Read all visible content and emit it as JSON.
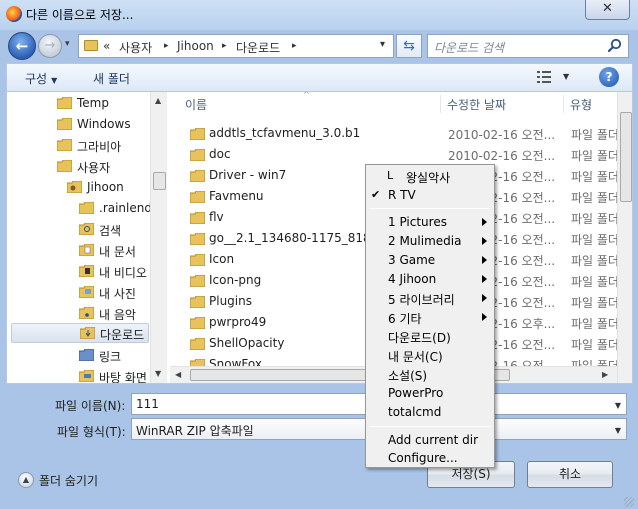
{
  "window": {
    "title": "다른 이름으로 저장...",
    "close_glyph": "✕"
  },
  "navigation": {
    "back_glyph": "←",
    "forward_glyph": "→",
    "dropdown_glyph": "▾"
  },
  "address": {
    "overflow": "«",
    "crumbs": [
      "사용자",
      "Jihoon",
      "다운로드"
    ],
    "separator": "▸",
    "refresh_glyph": "⇆"
  },
  "search": {
    "placeholder": "다운로드 검색"
  },
  "toolbar": {
    "organize": "구성",
    "new_folder": "새 폴더",
    "help": "?"
  },
  "nav_tree": [
    {
      "label": "Temp"
    },
    {
      "label": "Windows"
    },
    {
      "label": "그라비아"
    },
    {
      "label": "사용자"
    },
    {
      "label": "Jihoon"
    },
    {
      "label": ".rainlenda"
    },
    {
      "label": "검색"
    },
    {
      "label": "내 문서"
    },
    {
      "label": "내 비디오"
    },
    {
      "label": "내 사진"
    },
    {
      "label": "내 음악"
    },
    {
      "label": "다운로드"
    },
    {
      "label": "링크"
    },
    {
      "label": "바탕 화면"
    }
  ],
  "file_list": {
    "columns": [
      "이름",
      "수정한 날짜",
      "유형"
    ],
    "rows": [
      {
        "name": "addtls_tcfavmenu_3.0.b1",
        "date": "2010-02-16 오전...",
        "type": "파일 폴더"
      },
      {
        "name": "doc",
        "date": "2010-02-16 오전...",
        "type": "파일 폴더"
      },
      {
        "name": "Driver - win7",
        "date": "2010-02-16 오전...",
        "type": "파일 폴더"
      },
      {
        "name": "Favmenu",
        "date": "2010-02-16 오전...",
        "type": "파일 폴더"
      },
      {
        "name": "flv",
        "date": "2010-02-16 오전...",
        "type": "파일 폴더"
      },
      {
        "name": "go__2.1_134680-1175_818",
        "date": "2010-02-16 오전...",
        "type": "파일 폴더"
      },
      {
        "name": "Icon",
        "date": "2010-02-16 오전...",
        "type": "파일 폴더"
      },
      {
        "name": "Icon-png",
        "date": "2010-02-16 오전...",
        "type": "파일 폴더"
      },
      {
        "name": "Plugins",
        "date": "2010-02-16 오전...",
        "type": "파일 폴더"
      },
      {
        "name": "pwrpro49",
        "date": "2010-02-16 오후...",
        "type": "파일 폴더"
      },
      {
        "name": "ShellOpacity",
        "date": "2010-02-16 오전...",
        "type": "파일 폴더"
      },
      {
        "name": "SnowFox",
        "date": "2010-02-16 오전...",
        "type": "파일 폴더"
      }
    ]
  },
  "form": {
    "filename_label": "파일 이름(N):",
    "filename_value": "111",
    "filetype_label": "파일 형식(T):",
    "filetype_value": "WinRAR ZIP 압축파일"
  },
  "footer": {
    "hide_folders": "폴더 숨기기",
    "save": "저장(S)",
    "cancel": "취소"
  },
  "context_menu": {
    "items_top": [
      {
        "mark": "L",
        "label": "왕실악사"
      },
      {
        "mark": "✔",
        "label": "R   TV"
      }
    ],
    "items_sub": [
      {
        "label": "1 Pictures"
      },
      {
        "label": "2 Mulimedia"
      },
      {
        "label": "3 Game"
      },
      {
        "label": "4 Jihoon"
      },
      {
        "label": "5 라이브러리"
      },
      {
        "label": "6 기타"
      }
    ],
    "items_plain": [
      {
        "label": "다운로드(D)"
      },
      {
        "label": "내 문서(C)"
      },
      {
        "label": "소설(S)"
      },
      {
        "label": "PowerPro"
      },
      {
        "label": "totalcmd"
      }
    ],
    "items_bottom": [
      {
        "label": "Add current dir"
      },
      {
        "label": "Configure..."
      }
    ]
  },
  "colors": {
    "window_frame": "#a9c4e6",
    "folder": "#e8c25a",
    "accent": "#2b5fb5"
  }
}
